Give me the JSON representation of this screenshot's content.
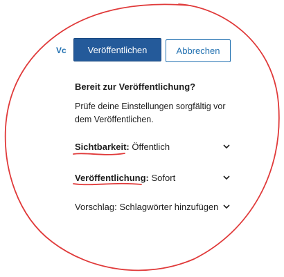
{
  "partial_label": "Vc",
  "toolbar": {
    "publish_label": "Veröffentlichen",
    "cancel_label": "Abbrechen"
  },
  "panel": {
    "heading": "Bereit zur Veröffentlichung?",
    "description": "Prüfe deine Einstellungen sorgfältig vor dem Veröffentlichen.",
    "rows": [
      {
        "label": "Sichtbarkeit:",
        "value": "Öffentlich",
        "icon": "chevron-down-icon"
      },
      {
        "label": "Veröffentlichung:",
        "value": "Sofort",
        "icon": "chevron-down-icon"
      },
      {
        "label": "Vorschlag:",
        "value": "Schlagwörter hinzufügen",
        "icon": "chevron-down-icon"
      }
    ]
  },
  "annotation_color": "#e03a3a",
  "colors": {
    "primary": "#245a9a",
    "link": "#2271b1"
  }
}
